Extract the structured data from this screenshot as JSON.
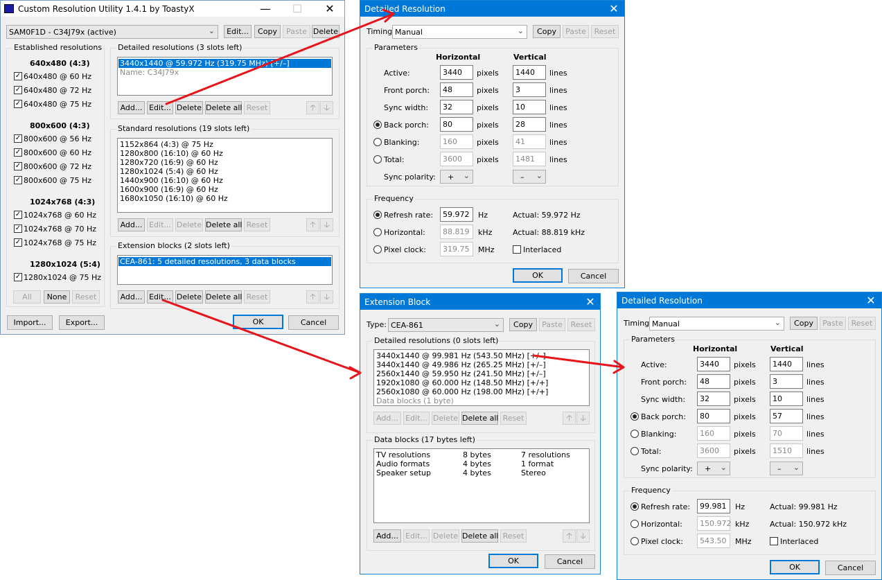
{
  "cru": {
    "title": "Custom Resolution Utility 1.4.1 by ToastyX",
    "monitor": "SAM0F1D - C34J79x (active)",
    "top_buttons": [
      "Edit...",
      "Copy",
      "Paste",
      "Delete"
    ],
    "established": {
      "label": "Established resolutions",
      "groups": [
        {
          "header": "640x480 (4:3)",
          "items": [
            "640x480 @ 60 Hz",
            "640x480 @ 72 Hz",
            "640x480 @ 75 Hz"
          ]
        },
        {
          "header": "800x600 (4:3)",
          "items": [
            "800x600 @ 56 Hz",
            "800x600 @ 60 Hz",
            "800x600 @ 72 Hz",
            "800x600 @ 75 Hz"
          ]
        },
        {
          "header": "1024x768 (4:3)",
          "items": [
            "1024x768 @ 60 Hz",
            "1024x768 @ 70 Hz",
            "1024x768 @ 75 Hz"
          ]
        },
        {
          "header": "1280x1024 (5:4)",
          "items": [
            "1280x1024 @ 75 Hz"
          ]
        }
      ],
      "buttons": [
        "All",
        "None",
        "Reset"
      ]
    },
    "detailed": {
      "label": "Detailed resolutions (3 slots left)",
      "items": [
        "3440x1440 @ 59.972 Hz (319.75 MHz) [+/–]",
        "Name: C34J79x"
      ]
    },
    "standard": {
      "label": "Standard resolutions (19 slots left)",
      "items": [
        "1152x864 (4:3) @ 75 Hz",
        "1280x800 (16:10) @ 60 Hz",
        "1280x720 (16:9) @ 60 Hz",
        "1280x1024 (5:4) @ 60 Hz",
        "1440x900 (16:10) @ 60 Hz",
        "1600x900 (16:9) @ 60 Hz",
        "1680x1050 (16:10) @ 60 Hz"
      ]
    },
    "extension": {
      "label": "Extension blocks (2 slots left)",
      "items": [
        "CEA-861: 5 detailed resolutions, 3 data blocks"
      ]
    },
    "list_buttons": [
      "Add...",
      "Edit...",
      "Delete",
      "Delete all",
      "Reset"
    ],
    "import": "Import...",
    "export": "Export...",
    "ok": "OK",
    "cancel": "Cancel"
  },
  "detail1": {
    "title": "Detailed Resolution",
    "timing_label": "Timing:",
    "timing": "Manual",
    "buttons": [
      "Copy",
      "Paste",
      "Reset"
    ],
    "params_label": "Parameters",
    "h_head": "Horizontal",
    "v_head": "Vertical",
    "rows": [
      {
        "label": "Active:",
        "h": "3440",
        "v": "1440"
      },
      {
        "label": "Front porch:",
        "h": "48",
        "v": "3"
      },
      {
        "label": "Sync width:",
        "h": "32",
        "v": "10"
      },
      {
        "label": "Back porch:",
        "h": "80",
        "v": "28"
      },
      {
        "label": "Blanking:",
        "h": "160",
        "v": "41"
      },
      {
        "label": "Total:",
        "h": "3600",
        "v": "1481"
      }
    ],
    "pixels": "pixels",
    "lines": "lines",
    "sync_label": "Sync polarity:",
    "sync_h": "+",
    "sync_v": "–",
    "freq_label": "Frequency",
    "freq_rows": [
      {
        "label": "Refresh rate:",
        "value": "59.972",
        "unit": "Hz",
        "actual": "Actual: 59.972 Hz"
      },
      {
        "label": "Horizontal:",
        "value": "88.819",
        "unit": "kHz",
        "actual": "Actual: 88.819 kHz"
      },
      {
        "label": "Pixel clock:",
        "value": "319.75",
        "unit": "MHz",
        "actual": "Interlaced"
      }
    ],
    "ok": "OK",
    "cancel": "Cancel"
  },
  "ext": {
    "title": "Extension Block",
    "type_label": "Type:",
    "type": "CEA-861",
    "buttons": [
      "Copy",
      "Paste",
      "Reset"
    ],
    "detailed_label": "Detailed resolutions (0 slots left)",
    "detailed_items": [
      "3440x1440 @ 99.981 Hz (543.50 MHz) [+/–]",
      "3440x1440 @ 49.986 Hz (265.25 MHz) [+/–]",
      "2560x1440 @ 59.950 Hz (241.50 MHz) [+/–]",
      "1920x1080 @ 60.000 Hz (148.50 MHz) [+/+]",
      "2560x1080 @ 60.000 Hz (198.00 MHz) [+/+]",
      "Data blocks (1 byte)"
    ],
    "data_label": "Data blocks (17 bytes left)",
    "data_rows": [
      {
        "name": "TV resolutions",
        "size": "8 bytes",
        "info": "7 resolutions"
      },
      {
        "name": "Audio formats",
        "size": "4 bytes",
        "info": "1 format"
      },
      {
        "name": "Speaker setup",
        "size": "4 bytes",
        "info": "Stereo"
      }
    ],
    "list_buttons": [
      "Add...",
      "Edit...",
      "Delete",
      "Delete all",
      "Reset"
    ],
    "ok": "OK",
    "cancel": "Cancel"
  },
  "detail2": {
    "title": "Detailed Resolution",
    "timing_label": "Timing:",
    "timing": "Manual",
    "buttons": [
      "Copy",
      "Paste",
      "Reset"
    ],
    "params_label": "Parameters",
    "h_head": "Horizontal",
    "v_head": "Vertical",
    "rows": [
      {
        "label": "Active:",
        "h": "3440",
        "v": "1440"
      },
      {
        "label": "Front porch:",
        "h": "48",
        "v": "3"
      },
      {
        "label": "Sync width:",
        "h": "32",
        "v": "10"
      },
      {
        "label": "Back porch:",
        "h": "80",
        "v": "57"
      },
      {
        "label": "Blanking:",
        "h": "160",
        "v": "70"
      },
      {
        "label": "Total:",
        "h": "3600",
        "v": "1510"
      }
    ],
    "pixels": "pixels",
    "lines": "lines",
    "sync_label": "Sync polarity:",
    "sync_h": "+",
    "sync_v": "–",
    "freq_label": "Frequency",
    "freq_rows": [
      {
        "label": "Refresh rate:",
        "value": "99.981",
        "unit": "Hz",
        "actual": "Actual: 99.981 Hz"
      },
      {
        "label": "Horizontal:",
        "value": "150.972",
        "unit": "kHz",
        "actual": "Actual: 150.972 kHz"
      },
      {
        "label": "Pixel clock:",
        "value": "543.50",
        "unit": "MHz",
        "actual": "Interlaced"
      }
    ],
    "ok": "OK",
    "cancel": "Cancel"
  },
  "colors": {
    "accent": "#0078d7",
    "arrow": "#e8141c"
  }
}
